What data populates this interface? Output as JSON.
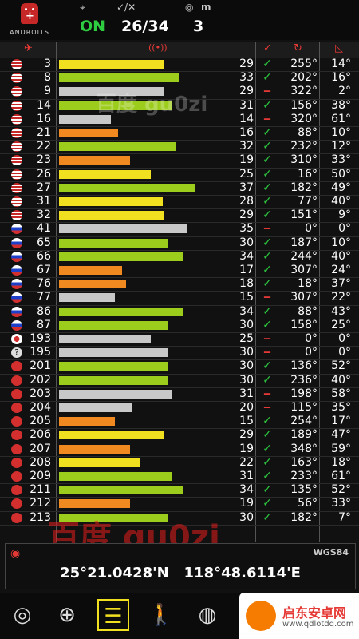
{
  "header": {
    "app_name": "ANDROITS",
    "status": "ON",
    "satellites": "26/34",
    "mode": "3",
    "mode_unit": "m"
  },
  "colors": {
    "green": "#9ccc1c",
    "yellow": "#f0e020",
    "orange": "#f08a20",
    "gray": "#c8c8c8",
    "check": "#2ecc40",
    "dash": "#e53935"
  },
  "rows": [
    {
      "flag": "us",
      "prn": "3",
      "snr": "29",
      "used": true,
      "az": "255°",
      "el": "14°",
      "bar": 0.55,
      "color": "yellow"
    },
    {
      "flag": "us",
      "prn": "8",
      "snr": "33",
      "used": true,
      "az": "202°",
      "el": "16°",
      "bar": 0.63,
      "color": "green"
    },
    {
      "flag": "us",
      "prn": "9",
      "snr": "29",
      "used": false,
      "az": "322°",
      "el": "2°",
      "bar": 0.55,
      "color": "gray"
    },
    {
      "flag": "us",
      "prn": "14",
      "snr": "31",
      "used": true,
      "az": "156°",
      "el": "38°",
      "bar": 0.59,
      "color": "green"
    },
    {
      "flag": "us",
      "prn": "16",
      "snr": "14",
      "used": false,
      "az": "320°",
      "el": "61°",
      "bar": 0.27,
      "color": "gray"
    },
    {
      "flag": "us",
      "prn": "21",
      "snr": "16",
      "used": true,
      "az": "88°",
      "el": "10°",
      "bar": 0.31,
      "color": "orange"
    },
    {
      "flag": "us",
      "prn": "22",
      "snr": "32",
      "used": true,
      "az": "232°",
      "el": "12°",
      "bar": 0.61,
      "color": "green"
    },
    {
      "flag": "us",
      "prn": "23",
      "snr": "19",
      "used": true,
      "az": "310°",
      "el": "33°",
      "bar": 0.37,
      "color": "orange"
    },
    {
      "flag": "us",
      "prn": "26",
      "snr": "25",
      "used": true,
      "az": "16°",
      "el": "50°",
      "bar": 0.48,
      "color": "yellow"
    },
    {
      "flag": "us",
      "prn": "27",
      "snr": "37",
      "used": true,
      "az": "182°",
      "el": "49°",
      "bar": 0.71,
      "color": "green"
    },
    {
      "flag": "us",
      "prn": "31",
      "snr": "28",
      "used": true,
      "az": "77°",
      "el": "40°",
      "bar": 0.54,
      "color": "yellow"
    },
    {
      "flag": "us",
      "prn": "32",
      "snr": "29",
      "used": true,
      "az": "151°",
      "el": "9°",
      "bar": 0.55,
      "color": "yellow"
    },
    {
      "flag": "ru",
      "prn": "41",
      "snr": "35",
      "used": false,
      "az": "0°",
      "el": "0°",
      "bar": 0.67,
      "color": "gray"
    },
    {
      "flag": "ru",
      "prn": "65",
      "snr": "30",
      "used": true,
      "az": "187°",
      "el": "10°",
      "bar": 0.57,
      "color": "green"
    },
    {
      "flag": "ru",
      "prn": "66",
      "snr": "34",
      "used": true,
      "az": "244°",
      "el": "40°",
      "bar": 0.65,
      "color": "green"
    },
    {
      "flag": "ru",
      "prn": "67",
      "snr": "17",
      "used": true,
      "az": "307°",
      "el": "24°",
      "bar": 0.33,
      "color": "orange"
    },
    {
      "flag": "ru",
      "prn": "76",
      "snr": "18",
      "used": true,
      "az": "18°",
      "el": "37°",
      "bar": 0.35,
      "color": "orange"
    },
    {
      "flag": "ru",
      "prn": "77",
      "snr": "15",
      "used": false,
      "az": "307°",
      "el": "22°",
      "bar": 0.29,
      "color": "gray"
    },
    {
      "flag": "ru",
      "prn": "86",
      "snr": "34",
      "used": true,
      "az": "88°",
      "el": "43°",
      "bar": 0.65,
      "color": "green"
    },
    {
      "flag": "ru",
      "prn": "87",
      "snr": "30",
      "used": true,
      "az": "158°",
      "el": "25°",
      "bar": 0.57,
      "color": "green"
    },
    {
      "flag": "jp",
      "prn": "193",
      "snr": "25",
      "used": false,
      "az": "0°",
      "el": "0°",
      "bar": 0.48,
      "color": "gray"
    },
    {
      "flag": "un",
      "prn": "195",
      "snr": "30",
      "used": false,
      "az": "0°",
      "el": "0°",
      "bar": 0.57,
      "color": "gray"
    },
    {
      "flag": "cn",
      "prn": "201",
      "snr": "30",
      "used": true,
      "az": "136°",
      "el": "52°",
      "bar": 0.57,
      "color": "green"
    },
    {
      "flag": "cn",
      "prn": "202",
      "snr": "30",
      "used": true,
      "az": "236°",
      "el": "40°",
      "bar": 0.57,
      "color": "green"
    },
    {
      "flag": "cn",
      "prn": "203",
      "snr": "31",
      "used": false,
      "az": "198°",
      "el": "58°",
      "bar": 0.59,
      "color": "gray"
    },
    {
      "flag": "cn",
      "prn": "204",
      "snr": "20",
      "used": false,
      "az": "115°",
      "el": "35°",
      "bar": 0.38,
      "color": "gray"
    },
    {
      "flag": "cn",
      "prn": "205",
      "snr": "15",
      "used": true,
      "az": "254°",
      "el": "17°",
      "bar": 0.29,
      "color": "orange"
    },
    {
      "flag": "cn",
      "prn": "206",
      "snr": "29",
      "used": true,
      "az": "189°",
      "el": "47°",
      "bar": 0.55,
      "color": "yellow"
    },
    {
      "flag": "cn",
      "prn": "207",
      "snr": "19",
      "used": true,
      "az": "348°",
      "el": "59°",
      "bar": 0.37,
      "color": "orange"
    },
    {
      "flag": "cn",
      "prn": "208",
      "snr": "22",
      "used": true,
      "az": "163°",
      "el": "18°",
      "bar": 0.42,
      "color": "yellow"
    },
    {
      "flag": "cn",
      "prn": "209",
      "snr": "31",
      "used": true,
      "az": "233°",
      "el": "61°",
      "bar": 0.59,
      "color": "green"
    },
    {
      "flag": "cn",
      "prn": "211",
      "snr": "34",
      "used": true,
      "az": "135°",
      "el": "52°",
      "bar": 0.65,
      "color": "green"
    },
    {
      "flag": "cn",
      "prn": "212",
      "snr": "19",
      "used": true,
      "az": "56°",
      "el": "33°",
      "bar": 0.37,
      "color": "orange"
    },
    {
      "flag": "cn",
      "prn": "213",
      "snr": "30",
      "used": true,
      "az": "182°",
      "el": "7°",
      "bar": 0.57,
      "color": "green"
    }
  ],
  "footer": {
    "datum": "WGS84",
    "latitude": "25°21.0428'N",
    "longitude": "118°48.6114'E"
  },
  "nav": [
    "compass-icon",
    "radar-icon",
    "signal-bars-icon",
    "walking-icon",
    "globe-icon",
    "map-pin-icon",
    "more-icon"
  ],
  "overlays": {
    "badge_title": "启东安卓网",
    "badge_url": "www.qdlotdq.com"
  }
}
